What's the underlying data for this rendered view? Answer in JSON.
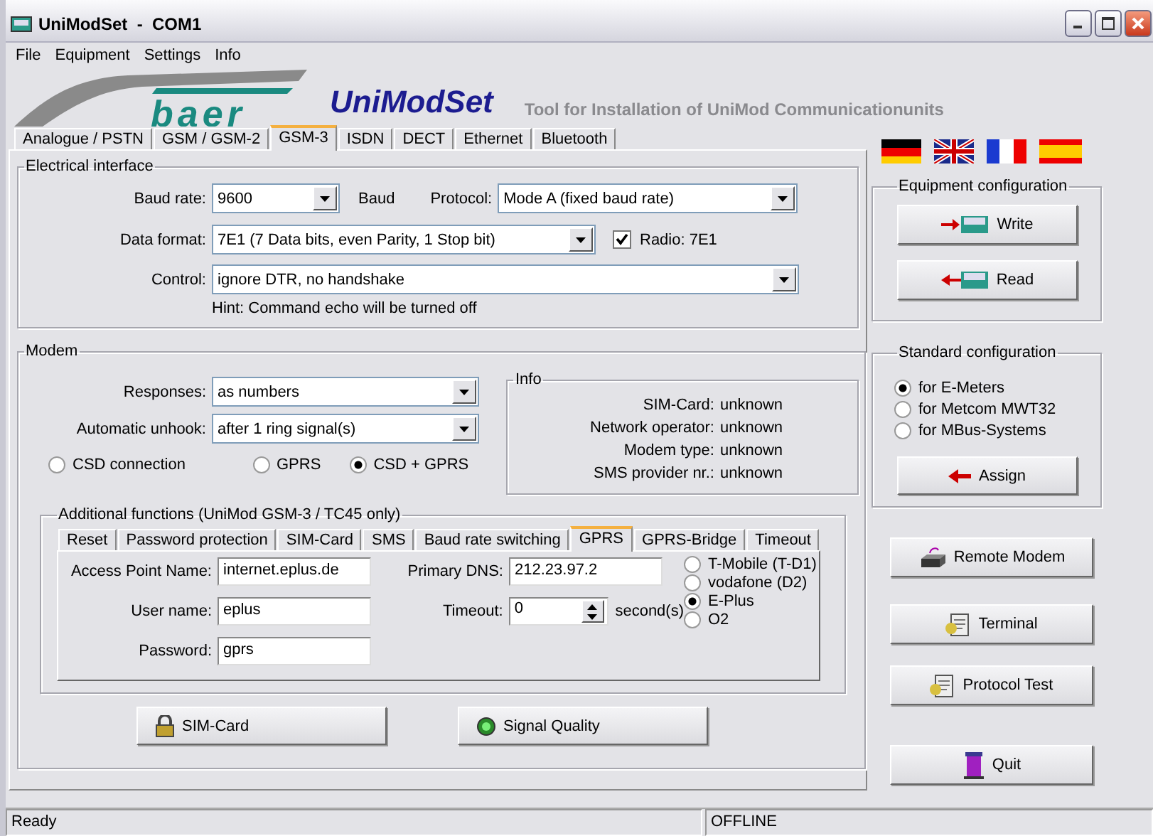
{
  "window": {
    "title": "UniModSet  -  COM1"
  },
  "menu": [
    "File",
    "Equipment",
    "Settings",
    "Info"
  ],
  "header": {
    "logo_text": "baer",
    "app_name": "UniModSet",
    "tagline": "Tool for Installation of UniMod Communicationunits"
  },
  "tabs": [
    {
      "label": "Analogue / PSTN",
      "selected": false
    },
    {
      "label": "GSM / GSM-2",
      "selected": false
    },
    {
      "label": "GSM-3",
      "selected": true
    },
    {
      "label": "ISDN",
      "selected": false
    },
    {
      "label": "DECT",
      "selected": false
    },
    {
      "label": "Ethernet",
      "selected": false
    },
    {
      "label": "Bluetooth",
      "selected": false
    }
  ],
  "electrical_interface": {
    "title": "Electrical interface",
    "baud_rate": {
      "label": "Baud rate:",
      "value": "9600",
      "unit": "Baud"
    },
    "protocol": {
      "label": "Protocol:",
      "value": "Mode A (fixed baud rate)"
    },
    "data_format": {
      "label": "Data format:",
      "value": "7E1 (7 Data bits, even Parity, 1 Stop bit)"
    },
    "radio_checkbox": {
      "label": "Radio: 7E1",
      "checked": true
    },
    "control": {
      "label": "Control:",
      "value": "ignore DTR, no handshake"
    },
    "hint": "Hint: Command echo will be turned off"
  },
  "modem": {
    "title": "Modem",
    "responses": {
      "label": "Responses:",
      "value": "as numbers"
    },
    "automatic_unhook": {
      "label": "Automatic unhook:",
      "value": "after 1 ring signal(s)"
    },
    "connection_types": [
      {
        "label": "CSD connection",
        "selected": false
      },
      {
        "label": "GPRS",
        "selected": false
      },
      {
        "label": "CSD + GPRS",
        "selected": true
      }
    ],
    "info": {
      "title": "Info",
      "rows": [
        {
          "label": "SIM-Card:",
          "value": "unknown"
        },
        {
          "label": "Network operator:",
          "value": "unknown"
        },
        {
          "label": "Modem type:",
          "value": "unknown"
        },
        {
          "label": "SMS provider nr.:",
          "value": "unknown"
        }
      ]
    },
    "additional_functions": {
      "title": "Additional functions (UniMod GSM-3 / TC45 only)",
      "tabs": [
        {
          "label": "Reset",
          "selected": false
        },
        {
          "label": "Password protection",
          "selected": false
        },
        {
          "label": "SIM-Card",
          "selected": false
        },
        {
          "label": "SMS",
          "selected": false
        },
        {
          "label": "Baud rate switching",
          "selected": false
        },
        {
          "label": "GPRS",
          "selected": true
        },
        {
          "label": "GPRS-Bridge",
          "selected": false
        },
        {
          "label": "Timeout",
          "selected": false
        }
      ],
      "fields": [
        {
          "label": "Access Point Name:",
          "value": "internet.eplus.de"
        },
        {
          "label": "User name:",
          "value": "eplus"
        },
        {
          "label": "Password:",
          "value": "gprs"
        }
      ],
      "primary_dns": {
        "label": "Primary DNS:",
        "value": "212.23.97.2"
      },
      "timeout": {
        "label": "Timeout:",
        "value": "0",
        "unit": "second(s)"
      },
      "providers": [
        {
          "label": "T-Mobile (T-D1)",
          "selected": false
        },
        {
          "label": "vodafone (D2)",
          "selected": false
        },
        {
          "label": "E-Plus",
          "selected": true
        },
        {
          "label": "O2",
          "selected": false
        }
      ]
    },
    "buttons": [
      "SIM-Card",
      "Signal Quality"
    ]
  },
  "equipment_configuration": {
    "title": "Equipment configuration",
    "buttons": [
      "Write",
      "Read"
    ]
  },
  "standard_configuration": {
    "title": "Standard configuration",
    "options": [
      {
        "label": "for E-Meters",
        "selected": true
      },
      {
        "label": "for Metcom MWT32",
        "selected": false
      },
      {
        "label": "for MBus-Systems",
        "selected": false
      }
    ],
    "button": "Assign"
  },
  "side_buttons": [
    "Remote Modem",
    "Terminal",
    "Protocol Test",
    "Quit"
  ],
  "status_bar": [
    "Ready",
    "OFFLINE"
  ]
}
